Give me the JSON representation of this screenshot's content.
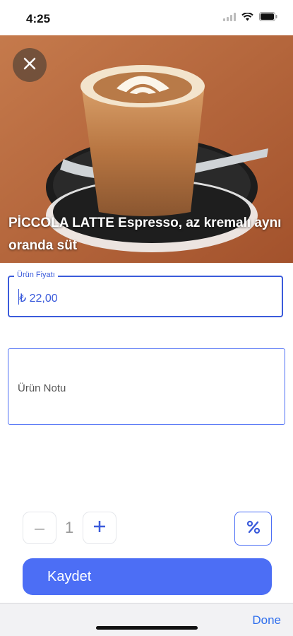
{
  "status_bar": {
    "time": "4:25"
  },
  "product": {
    "title": "PİCCOLA LATTE Espresso, az kremalı aynı oranda süt",
    "image_icon": "coffee-latte-photo"
  },
  "form": {
    "price_label": "Ürün Fiyatı",
    "price_value": "₺ 22,00",
    "note_placeholder": "Ürün Notu"
  },
  "quantity": {
    "decrement": "−",
    "value": "1",
    "increment": "+"
  },
  "save_label": "Kaydet",
  "toolbar": {
    "done_label": "Done"
  },
  "colors": {
    "accent": "#4c6ef5",
    "field_border": "#3b5bdb"
  }
}
